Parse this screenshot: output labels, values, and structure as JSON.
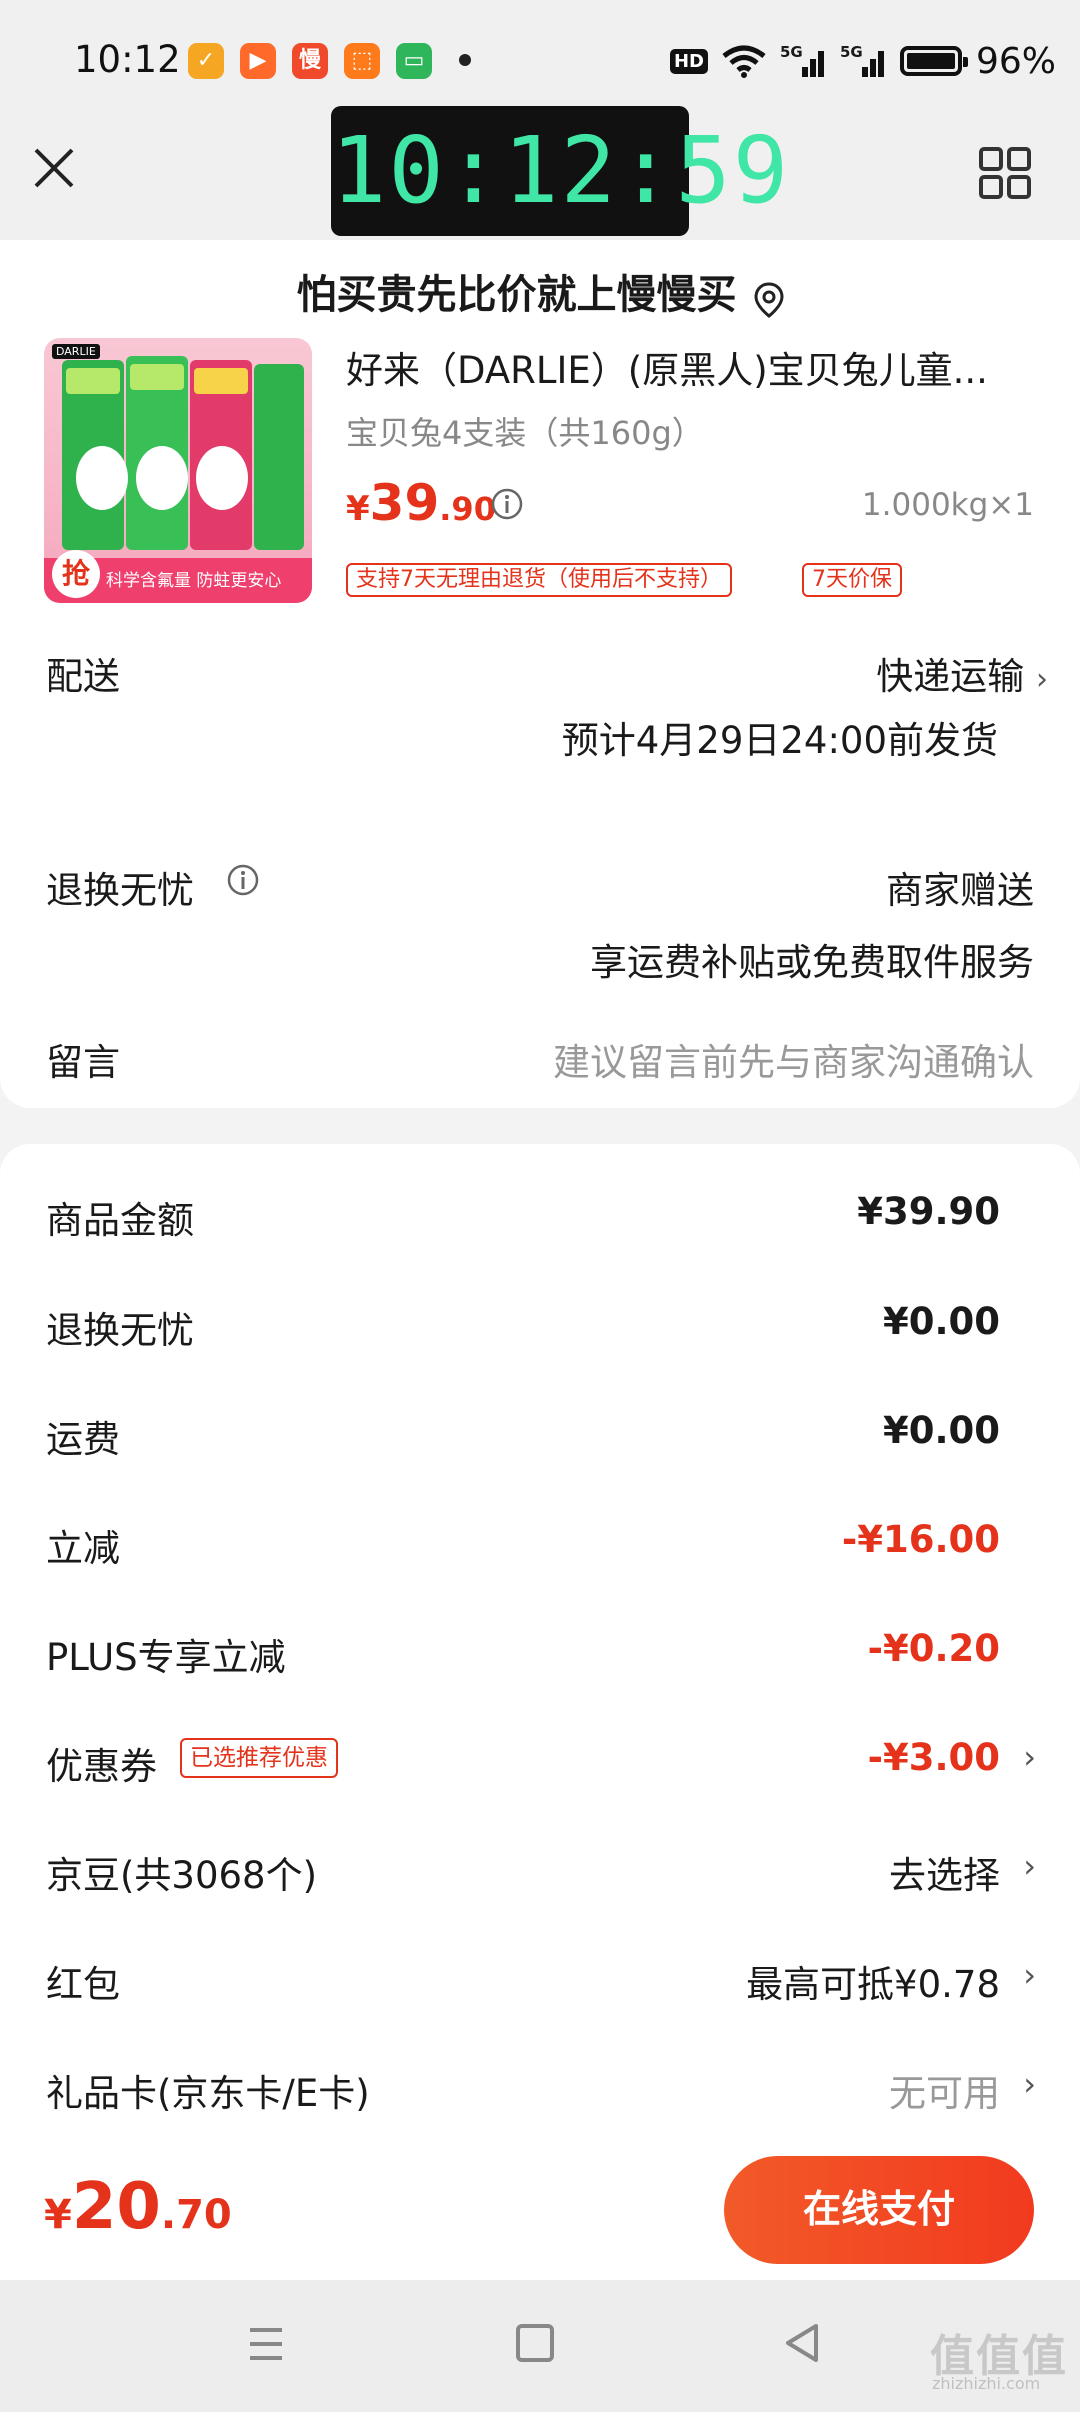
{
  "status_bar": {
    "time": "10:12",
    "apps": [
      "慢"
    ],
    "battery_percent": "96%",
    "network": [
      "HD",
      "5G",
      "5G"
    ]
  },
  "header": {
    "clock": "10:12:59",
    "slogan": "怕买贵先比价就上慢慢买"
  },
  "product": {
    "title": "好来（DARLIE）(原黑人)宝贝兔儿童...",
    "spec": "宝贝兔4支装（共160g）",
    "price_symbol": "¥",
    "price_int": "39",
    "price_dec": ".90",
    "weight_qty": "1.000kg×1",
    "tags": [
      "支持7天无理由退货（使用后不支持）",
      "7天价保"
    ],
    "thumb": {
      "brand": "DARLIE",
      "grab_badge": "抢",
      "caption": "科学含氟量 防蛀更安心"
    }
  },
  "delivery": {
    "label": "配送",
    "method": "快递运输",
    "estimate": "预计4月29日24:00前发货"
  },
  "returns": {
    "label": "退换无忧",
    "value": "商家赠送",
    "desc": "享运费补贴或免费取件服务"
  },
  "note": {
    "label": "留言",
    "placeholder": "建议留言前先与商家沟通确认"
  },
  "summary": {
    "goods_amount": {
      "label": "商品金额",
      "value": "¥39.90"
    },
    "returns_fee": {
      "label": "退换无忧",
      "value": "¥0.00"
    },
    "shipping": {
      "label": "运费",
      "value": "¥0.00"
    },
    "instant_off": {
      "label": "立减",
      "value": "-¥16.00"
    },
    "plus_off": {
      "label": "PLUS专享立减",
      "value": "-¥0.20"
    },
    "coupon": {
      "label": "优惠券",
      "tag": "已选推荐优惠",
      "value": "-¥3.00"
    },
    "jd_beans": {
      "label": "京豆(共3068个)",
      "value": "去选择"
    },
    "red_packet": {
      "label": "红包",
      "value": "最高可抵¥0.78"
    },
    "gift_card": {
      "label": "礼品卡(京东卡/E卡)",
      "value": "无可用"
    }
  },
  "pay_bar": {
    "total_symbol": "¥",
    "total_int": "20",
    "total_dec": ".70",
    "pay_button": "在线支付"
  },
  "watermark": {
    "text": "值值值",
    "url": "zhizhizhi.com"
  },
  "colors": {
    "accent_red": "#e4321b",
    "clock_green": "#3fe6a6",
    "pay_gradient_start": "#f25a28",
    "pay_gradient_end": "#f23a1f"
  }
}
